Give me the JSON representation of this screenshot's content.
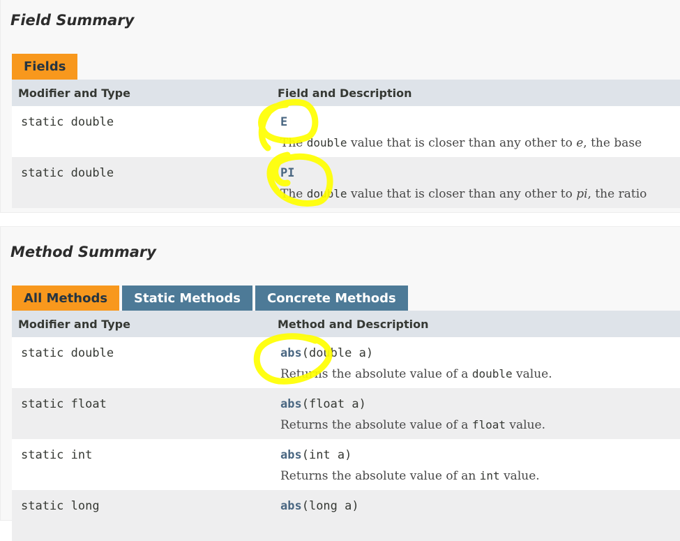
{
  "field_summary": {
    "heading": "Field Summary",
    "tab": "Fields",
    "columns": [
      "Modifier and Type",
      "Field and Description"
    ],
    "rows": [
      {
        "modifier": "static double",
        "name": "E",
        "desc_pre": "The ",
        "desc_code": "double",
        "desc_mid": " value that is closer than any other to ",
        "desc_em": "e",
        "desc_post": ", the base"
      },
      {
        "modifier": "static double",
        "name": "PI",
        "desc_pre": "The ",
        "desc_code": "double",
        "desc_mid": " value that is closer than any other to ",
        "desc_em": "pi",
        "desc_post": ", the ratio"
      }
    ]
  },
  "method_summary": {
    "heading": "Method Summary",
    "tabs": [
      "All Methods",
      "Static Methods",
      "Concrete Methods"
    ],
    "columns": [
      "Modifier and Type",
      "Method and Description"
    ],
    "rows": [
      {
        "modifier": "static double",
        "name": "abs",
        "params": "(double a)",
        "desc_pre": "Returns the absolute value of a ",
        "desc_code": "double",
        "desc_post": " value."
      },
      {
        "modifier": "static float",
        "name": "abs",
        "params": "(float a)",
        "desc_pre": "Returns the absolute value of a ",
        "desc_code": "float",
        "desc_post": " value."
      },
      {
        "modifier": "static int",
        "name": "abs",
        "params": "(int a)",
        "desc_pre": "Returns the absolute value of an ",
        "desc_code": "int",
        "desc_post": " value."
      },
      {
        "modifier": "static long",
        "name": "abs",
        "params": "(long a)",
        "desc_pre": "",
        "desc_code": "",
        "desc_post": ""
      }
    ]
  },
  "annotation": {
    "color": "#ffff00",
    "shapes": [
      "circle-field-E",
      "circle-field-PI",
      "circle-method-abs"
    ]
  }
}
